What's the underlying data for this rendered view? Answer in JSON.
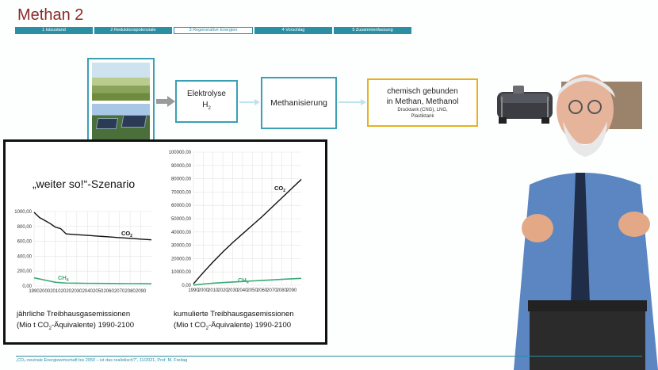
{
  "slide": {
    "title": "Methan 2",
    "nav_tabs": [
      {
        "label": "1 Istzustand",
        "active": false
      },
      {
        "label": "2 Reduktionspotenziale",
        "active": false
      },
      {
        "label": "3 Regenerative Energien",
        "active": true
      },
      {
        "label": "4 Vorschlag",
        "active": false
      },
      {
        "label": "5 Zusammenfassung",
        "active": false
      }
    ],
    "flow": {
      "elektrolyse_line1": "Elektrolyse",
      "elektrolyse_line2": "H",
      "elektrolyse_sub": "2",
      "methanisierung": "Methanisierung",
      "chem_line1": "chemisch gebunden",
      "chem_line2": "in Methan, Methanol",
      "chem_small1": "Drucktank (CNG), LNG,",
      "chem_small2": "Plastiktank"
    },
    "scenario_title": "„weiter so!“-Szenario",
    "caption_left_line1": "jährliche Treibhausgasemissionen",
    "caption_left_line2": "(Mio t CO",
    "caption_left_sub": "2",
    "caption_left_line2b": "-Äquivalente) 1990-2100",
    "caption_right_line1": "kumulierte Treibhausgasemissionen",
    "caption_right_line2": "(Mio t CO",
    "caption_right_sub": "2",
    "caption_right_line2b": "-Äquivalente) 1990-2100",
    "footer": "„CO₂-neutrale Energiewirtschaft bis 2050 – ist das realistisch?“, 11/2021, Prof. M. Freitag"
  },
  "colors": {
    "accent": "#2b8fa4",
    "title": "#8b2a2a",
    "co2_line": "#111111",
    "ch4_line": "#3aa878",
    "chem_border": "#e8b21f"
  },
  "chart_data": [
    {
      "type": "line",
      "x": [
        1990,
        1995,
        2000,
        2005,
        2010,
        2015,
        2020,
        2030,
        2040,
        2050,
        2060,
        2070,
        2080,
        2090,
        2100
      ],
      "series": [
        {
          "name": "CO2",
          "values": [
            990,
            920,
            880,
            840,
            790,
            770,
            700,
            690,
            680,
            670,
            660,
            650,
            640,
            630,
            620
          ]
        },
        {
          "name": "CH4",
          "values": [
            110,
            95,
            80,
            65,
            50,
            45,
            40,
            38,
            36,
            35,
            34,
            33,
            32,
            31,
            30
          ]
        }
      ],
      "ylim": [
        0,
        1000
      ],
      "yticks": [
        "0,00",
        "200,00",
        "400,00",
        "600,00",
        "800,00",
        "1000,00"
      ],
      "xticks": [
        "1990",
        "2000",
        "2010",
        "2020",
        "2030",
        "2040",
        "2050",
        "2060",
        "2070",
        "2080",
        "2090"
      ],
      "labels": {
        "co2": "CO",
        "ch4": "CH",
        "co2_sub": "2",
        "ch4_sub": "4"
      }
    },
    {
      "type": "line",
      "x": [
        1990,
        2000,
        2010,
        2020,
        2030,
        2040,
        2050,
        2060,
        2070,
        2080,
        2090,
        2100
      ],
      "series": [
        {
          "name": "CO2",
          "values": [
            1000,
            9500,
            17500,
            25000,
            32000,
            38500,
            45000,
            51500,
            58500,
            65500,
            72500,
            79500
          ]
        },
        {
          "name": "CH4",
          "values": [
            100,
            900,
            1500,
            2000,
            2400,
            2800,
            3200,
            3600,
            4000,
            4400,
            4800,
            5200
          ]
        }
      ],
      "ylim": [
        0,
        100000
      ],
      "yticks": [
        "0,00",
        "10000,00",
        "20000,00",
        "30000,00",
        "40000,00",
        "50000,00",
        "60000,00",
        "70000,00",
        "80000,00",
        "90000,00",
        "100000,00"
      ],
      "xticks": [
        "1990",
        "2000",
        "2010",
        "2020",
        "2030",
        "2040",
        "2050",
        "2060",
        "2070",
        "2080",
        "2090"
      ],
      "labels": {
        "co2": "CO",
        "ch4": "CH",
        "co2_sub": "2",
        "ch4_sub": "4"
      }
    }
  ]
}
